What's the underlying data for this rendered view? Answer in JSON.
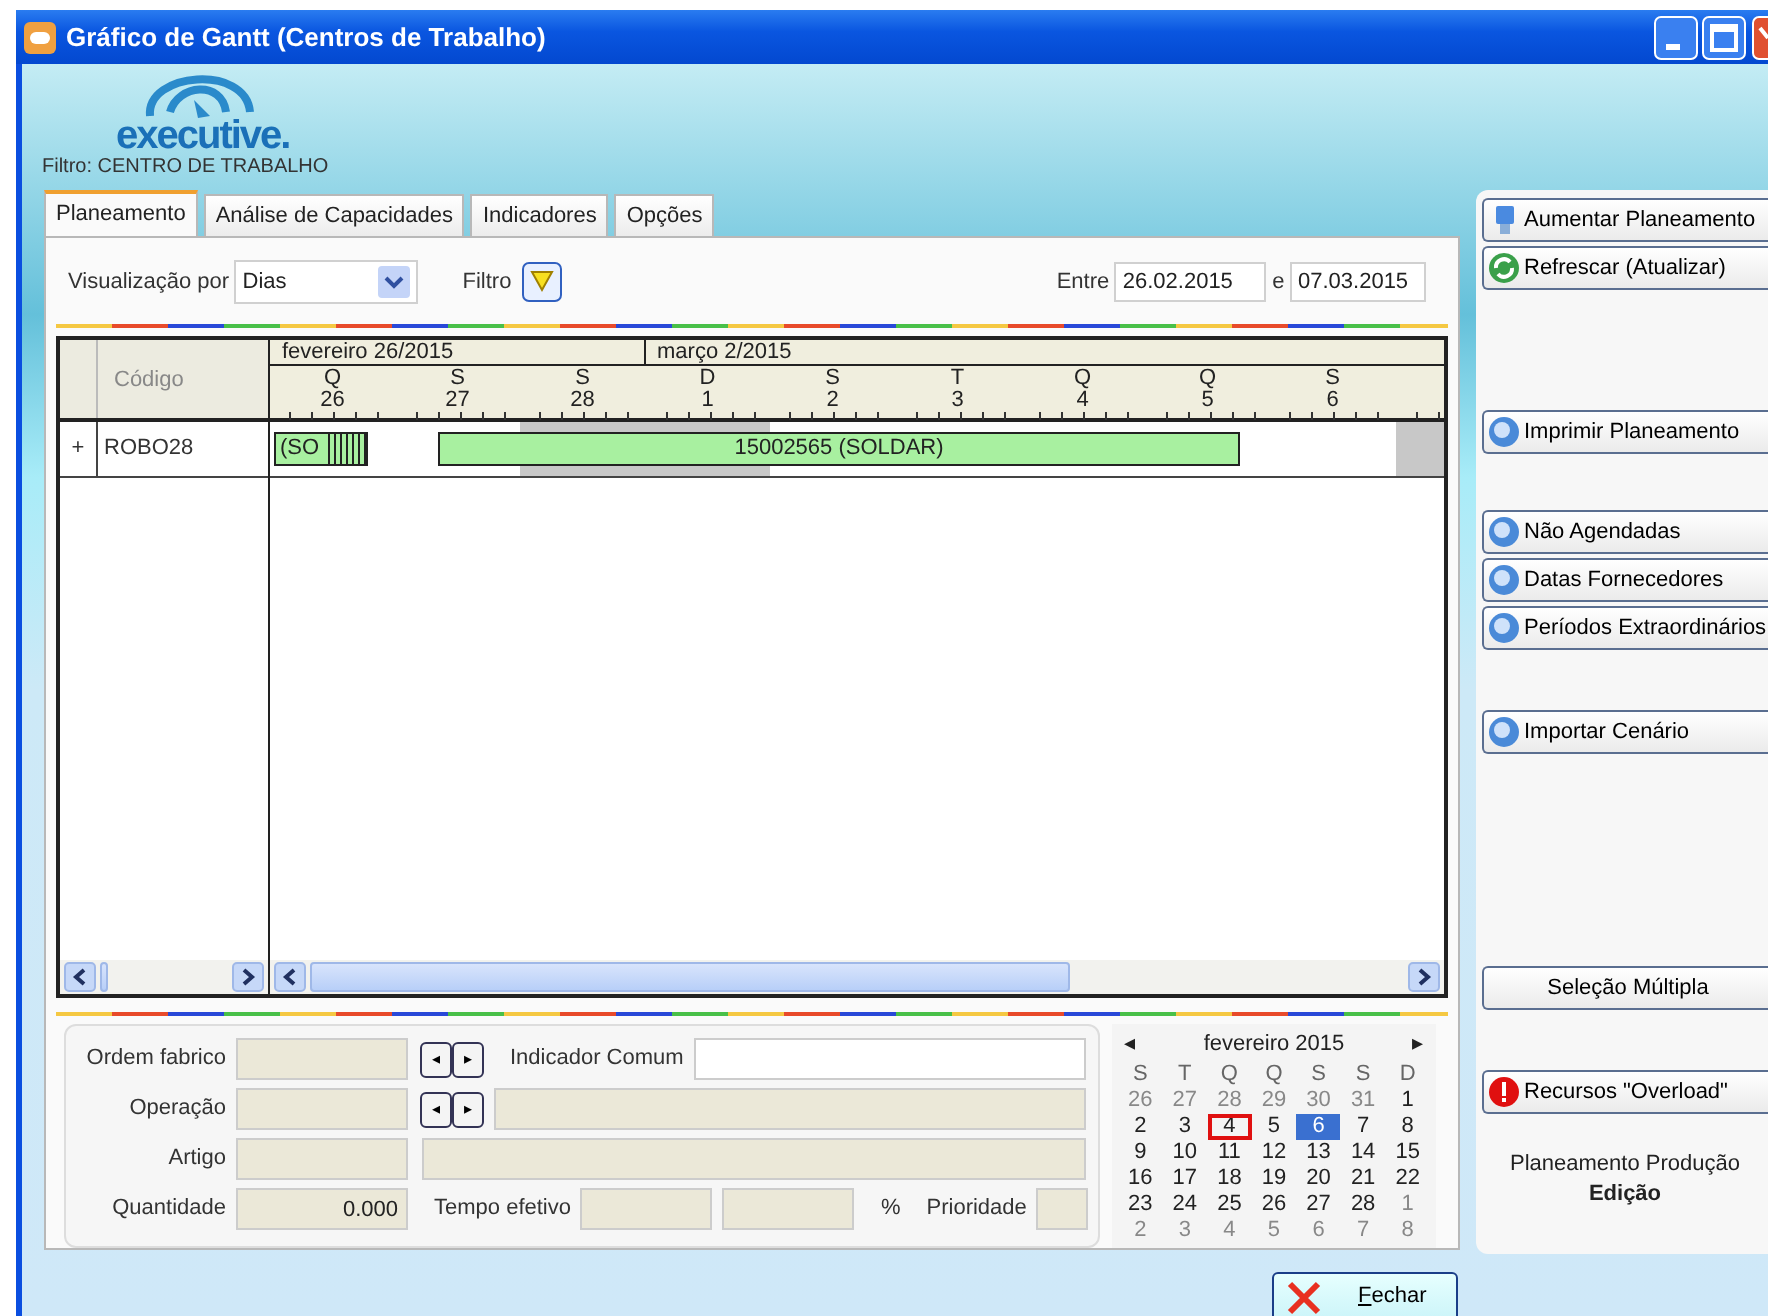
{
  "window": {
    "title": "Gráfico de Gantt (Centros de Trabalho)"
  },
  "logo": {
    "text": "executive."
  },
  "filter_caption": "Filtro: CENTRO DE TRABALHO",
  "tabs": [
    {
      "label": "Planeamento",
      "selected": true
    },
    {
      "label": "Análise de Capacidades",
      "selected": false
    },
    {
      "label": "Indicadores",
      "selected": false
    },
    {
      "label": "Opções",
      "selected": false
    }
  ],
  "toolbar": {
    "view_label": "Visualização por",
    "view_value": "Dias",
    "filter_label": "Filtro",
    "between_label": "Entre",
    "date_from": "26.02.2015",
    "and_label": "e",
    "date_to": "07.03.2015"
  },
  "gantt": {
    "code_header": "Código",
    "months": [
      {
        "label": "fevereiro 26/2015",
        "days": [
          {
            "weekday": "Q",
            "day": "26",
            "weekend": false
          },
          {
            "weekday": "S",
            "day": "27",
            "weekend": false
          },
          {
            "weekday": "S",
            "day": "28",
            "weekend": true
          }
        ]
      },
      {
        "label": "março 2/2015",
        "days": [
          {
            "weekday": "D",
            "day": "1",
            "weekend": true
          },
          {
            "weekday": "S",
            "day": "2",
            "weekend": false
          },
          {
            "weekday": "T",
            "day": "3",
            "weekend": false
          },
          {
            "weekday": "Q",
            "day": "4",
            "weekend": false
          },
          {
            "weekday": "Q",
            "day": "5",
            "weekend": false
          },
          {
            "weekday": "S",
            "day": "6",
            "weekend": false
          },
          {
            "weekend": true
          }
        ]
      }
    ],
    "rows": [
      {
        "expander": "+",
        "code": "ROBO28",
        "bars": [
          {
            "kind": "striped",
            "label": "(SO"
          },
          {
            "kind": "plain",
            "label": "15002565 (SOLDAR)"
          }
        ]
      }
    ]
  },
  "form": {
    "rows": [
      [
        {
          "kind": "label",
          "text": "Ordem fabrico"
        },
        {
          "kind": "short-field",
          "disabled": true
        },
        {
          "kind": "nav",
          "prev": "◂",
          "next": "▸"
        },
        {
          "kind": "label",
          "text": "Indicador Comum"
        },
        {
          "kind": "wide-field",
          "disabled": false
        }
      ],
      [
        {
          "kind": "label",
          "text": "Operação"
        },
        {
          "kind": "short-field",
          "disabled": true
        },
        {
          "kind": "nav",
          "prev": "◂",
          "next": "▸"
        },
        {
          "kind": "wide-field",
          "disabled": true
        }
      ],
      [
        {
          "kind": "label",
          "text": "Artigo"
        },
        {
          "kind": "short-field",
          "disabled": true
        },
        {
          "kind": "wide-field",
          "disabled": true
        }
      ],
      [
        {
          "kind": "label",
          "text": "Quantidade"
        },
        {
          "kind": "short-field",
          "disabled": true,
          "value": "0.000"
        },
        {
          "kind": "label",
          "text": "Tempo efetivo"
        },
        {
          "kind": "mid-field",
          "disabled": true
        },
        {
          "kind": "mid-field",
          "disabled": true
        },
        {
          "kind": "label",
          "text": "%"
        },
        {
          "kind": "label",
          "text": "Prioridade"
        },
        {
          "kind": "tiny-field",
          "disabled": true
        }
      ]
    ]
  },
  "calendar": {
    "prev": "◂",
    "month": "fevereiro 2015",
    "next": "▸",
    "weekdays": [
      "S",
      "T",
      "Q",
      "Q",
      "S",
      "S",
      "D"
    ],
    "days": [
      {
        "day": "26",
        "other_month": true,
        "today": false,
        "selected": false
      },
      {
        "day": "27",
        "other_month": true,
        "today": false,
        "selected": false
      },
      {
        "day": "28",
        "other_month": true,
        "today": false,
        "selected": false
      },
      {
        "day": "29",
        "other_month": true,
        "today": false,
        "selected": false
      },
      {
        "day": "30",
        "other_month": true,
        "today": false,
        "selected": false
      },
      {
        "day": "31",
        "other_month": true,
        "today": false,
        "selected": false
      },
      {
        "day": "1",
        "other_month": false,
        "today": false,
        "selected": false
      },
      {
        "day": "2",
        "other_month": false,
        "today": false,
        "selected": false
      },
      {
        "day": "3",
        "other_month": false,
        "today": false,
        "selected": false
      },
      {
        "day": "4",
        "other_month": false,
        "today": true,
        "selected": false
      },
      {
        "day": "5",
        "other_month": false,
        "today": false,
        "selected": false
      },
      {
        "day": "6",
        "other_month": false,
        "today": false,
        "selected": true
      },
      {
        "day": "7",
        "other_month": false,
        "today": false,
        "selected": false
      },
      {
        "day": "8",
        "other_month": false,
        "today": false,
        "selected": false
      },
      {
        "day": "9",
        "other_month": false,
        "today": false,
        "selected": false
      },
      {
        "day": "10",
        "other_month": false,
        "today": false,
        "selected": false
      },
      {
        "day": "11",
        "other_month": false,
        "today": false,
        "selected": false
      },
      {
        "day": "12",
        "other_month": false,
        "today": false,
        "selected": false
      },
      {
        "day": "13",
        "other_month": false,
        "today": false,
        "selected": false
      },
      {
        "day": "14",
        "other_month": false,
        "today": false,
        "selected": false
      },
      {
        "day": "15",
        "other_month": false,
        "today": false,
        "selected": false
      },
      {
        "day": "16",
        "other_month": false,
        "today": false,
        "selected": false
      },
      {
        "day": "17",
        "other_month": false,
        "today": false,
        "selected": false
      },
      {
        "day": "18",
        "other_month": false,
        "today": false,
        "selected": false
      },
      {
        "day": "19",
        "other_month": false,
        "today": false,
        "selected": false
      },
      {
        "day": "20",
        "other_month": false,
        "today": false,
        "selected": false
      },
      {
        "day": "21",
        "other_month": false,
        "today": false,
        "selected": false
      },
      {
        "day": "22",
        "other_month": false,
        "today": false,
        "selected": false
      },
      {
        "day": "23",
        "other_month": false,
        "today": false,
        "selected": false
      },
      {
        "day": "24",
        "other_month": false,
        "today": false,
        "selected": false
      },
      {
        "day": "25",
        "other_month": false,
        "today": false,
        "selected": false
      },
      {
        "day": "26",
        "other_month": false,
        "today": false,
        "selected": false
      },
      {
        "day": "27",
        "other_month": false,
        "today": false,
        "selected": false
      },
      {
        "day": "28",
        "other_month": false,
        "today": false,
        "selected": false
      },
      {
        "day": "1",
        "other_month": true,
        "today": false,
        "selected": false
      },
      {
        "day": "2",
        "other_month": true,
        "today": false,
        "selected": false
      },
      {
        "day": "3",
        "other_month": true,
        "today": false,
        "selected": false
      },
      {
        "day": "4",
        "other_month": true,
        "today": false,
        "selected": false
      },
      {
        "day": "5",
        "other_month": true,
        "today": false,
        "selected": false
      },
      {
        "day": "6",
        "other_month": true,
        "today": false,
        "selected": false
      },
      {
        "day": "7",
        "other_month": true,
        "today": false,
        "selected": false
      },
      {
        "day": "8",
        "other_month": true,
        "today": false,
        "selected": false
      }
    ]
  },
  "sidebar": {
    "groups": [
      [
        {
          "label": "Aumentar Planeamento"
        },
        {
          "label": "Refrescar (Atualizar)"
        }
      ],
      [
        {
          "label": "Imprimir Planeamento"
        }
      ],
      [
        {
          "label": "Não Agendadas"
        },
        {
          "label": "Datas Fornecedores"
        },
        {
          "label": "Períodos Extraordinários"
        }
      ],
      [
        {
          "label": "Importar Cenário"
        }
      ],
      [
        {
          "label": "Seleção Múltipla"
        }
      ],
      [
        {
          "label": "Recursos \"Overload\""
        }
      ]
    ],
    "caption": "Planeamento Produção",
    "mode": "Edição"
  },
  "close_button": {
    "label": "Fechar"
  }
}
